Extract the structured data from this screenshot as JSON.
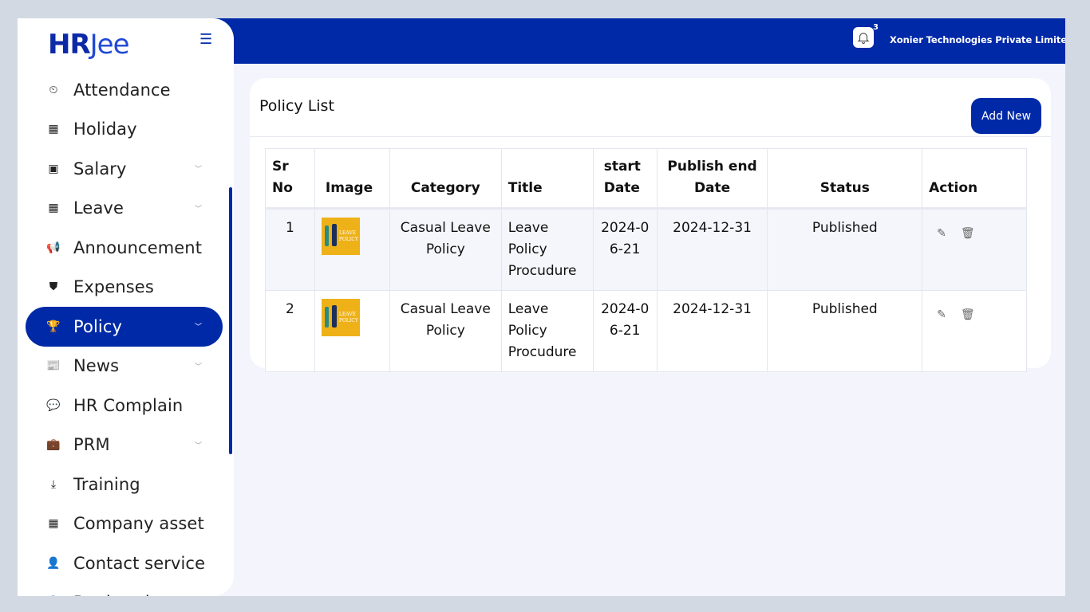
{
  "topbar": {
    "notification_count": "3",
    "company_name": "Xonier Technologies Private Limited"
  },
  "sidebar": {
    "logo_main": "HR",
    "logo_suffix": "Jee",
    "items": [
      {
        "label": "Attendance",
        "icon": "clock-icon",
        "glyph": "⏲",
        "chevron": false,
        "active": false
      },
      {
        "label": "Holiday",
        "icon": "calendar-icon",
        "glyph": "▦",
        "chevron": false,
        "active": false
      },
      {
        "label": "Salary",
        "icon": "money-icon",
        "glyph": "▣",
        "chevron": true,
        "active": false
      },
      {
        "label": "Leave",
        "icon": "calendar-icon",
        "glyph": "▦",
        "chevron": true,
        "active": false
      },
      {
        "label": "Announcement",
        "icon": "megaphone-icon",
        "glyph": "📢",
        "chevron": false,
        "active": false
      },
      {
        "label": "Expenses",
        "icon": "shield-icon",
        "glyph": "⛊",
        "chevron": false,
        "active": false
      },
      {
        "label": "Policy",
        "icon": "trophy-icon",
        "glyph": "🏆",
        "chevron": true,
        "active": true
      },
      {
        "label": "News",
        "icon": "newspaper-icon",
        "glyph": "📰",
        "chevron": true,
        "active": false
      },
      {
        "label": "HR Complain",
        "icon": "comments-icon",
        "glyph": "💬",
        "chevron": false,
        "active": false
      },
      {
        "label": "PRM",
        "icon": "briefcase-icon",
        "glyph": "💼",
        "chevron": true,
        "active": false
      },
      {
        "label": "Training",
        "icon": "download-icon",
        "glyph": "⤓",
        "chevron": false,
        "active": false
      },
      {
        "label": "Company asset",
        "icon": "calendar-icon",
        "glyph": "▦",
        "chevron": false,
        "active": false
      },
      {
        "label": "Contact service",
        "icon": "user-icon",
        "glyph": "👤",
        "chevron": false,
        "active": false
      },
      {
        "label": "Declaration",
        "icon": "user-icon",
        "glyph": "👤",
        "chevron": false,
        "active": false
      }
    ]
  },
  "main": {
    "title": "Policy List",
    "add_button": "Add New",
    "columns": [
      "Sr No",
      "Image",
      "Category",
      "Title",
      "start Date",
      "Publish end Date",
      "Status",
      "Action"
    ],
    "rows": [
      {
        "sr": "1",
        "image_text": "LEAVE POLICY",
        "category": "Casual Leave Policy",
        "title": "Leave Policy Procudure",
        "start": "2024-06-21",
        "end": "2024-12-31",
        "status": "Published"
      },
      {
        "sr": "2",
        "image_text": "LEAVE POLICY",
        "category": "Casual Leave Policy",
        "title": "Leave Policy Procudure",
        "start": "2024-06-21",
        "end": "2024-12-31",
        "status": "Published"
      }
    ]
  },
  "colors": {
    "primary": "#0029a8",
    "background": "#f3f4fc",
    "thumbnail": "#eeb118"
  }
}
